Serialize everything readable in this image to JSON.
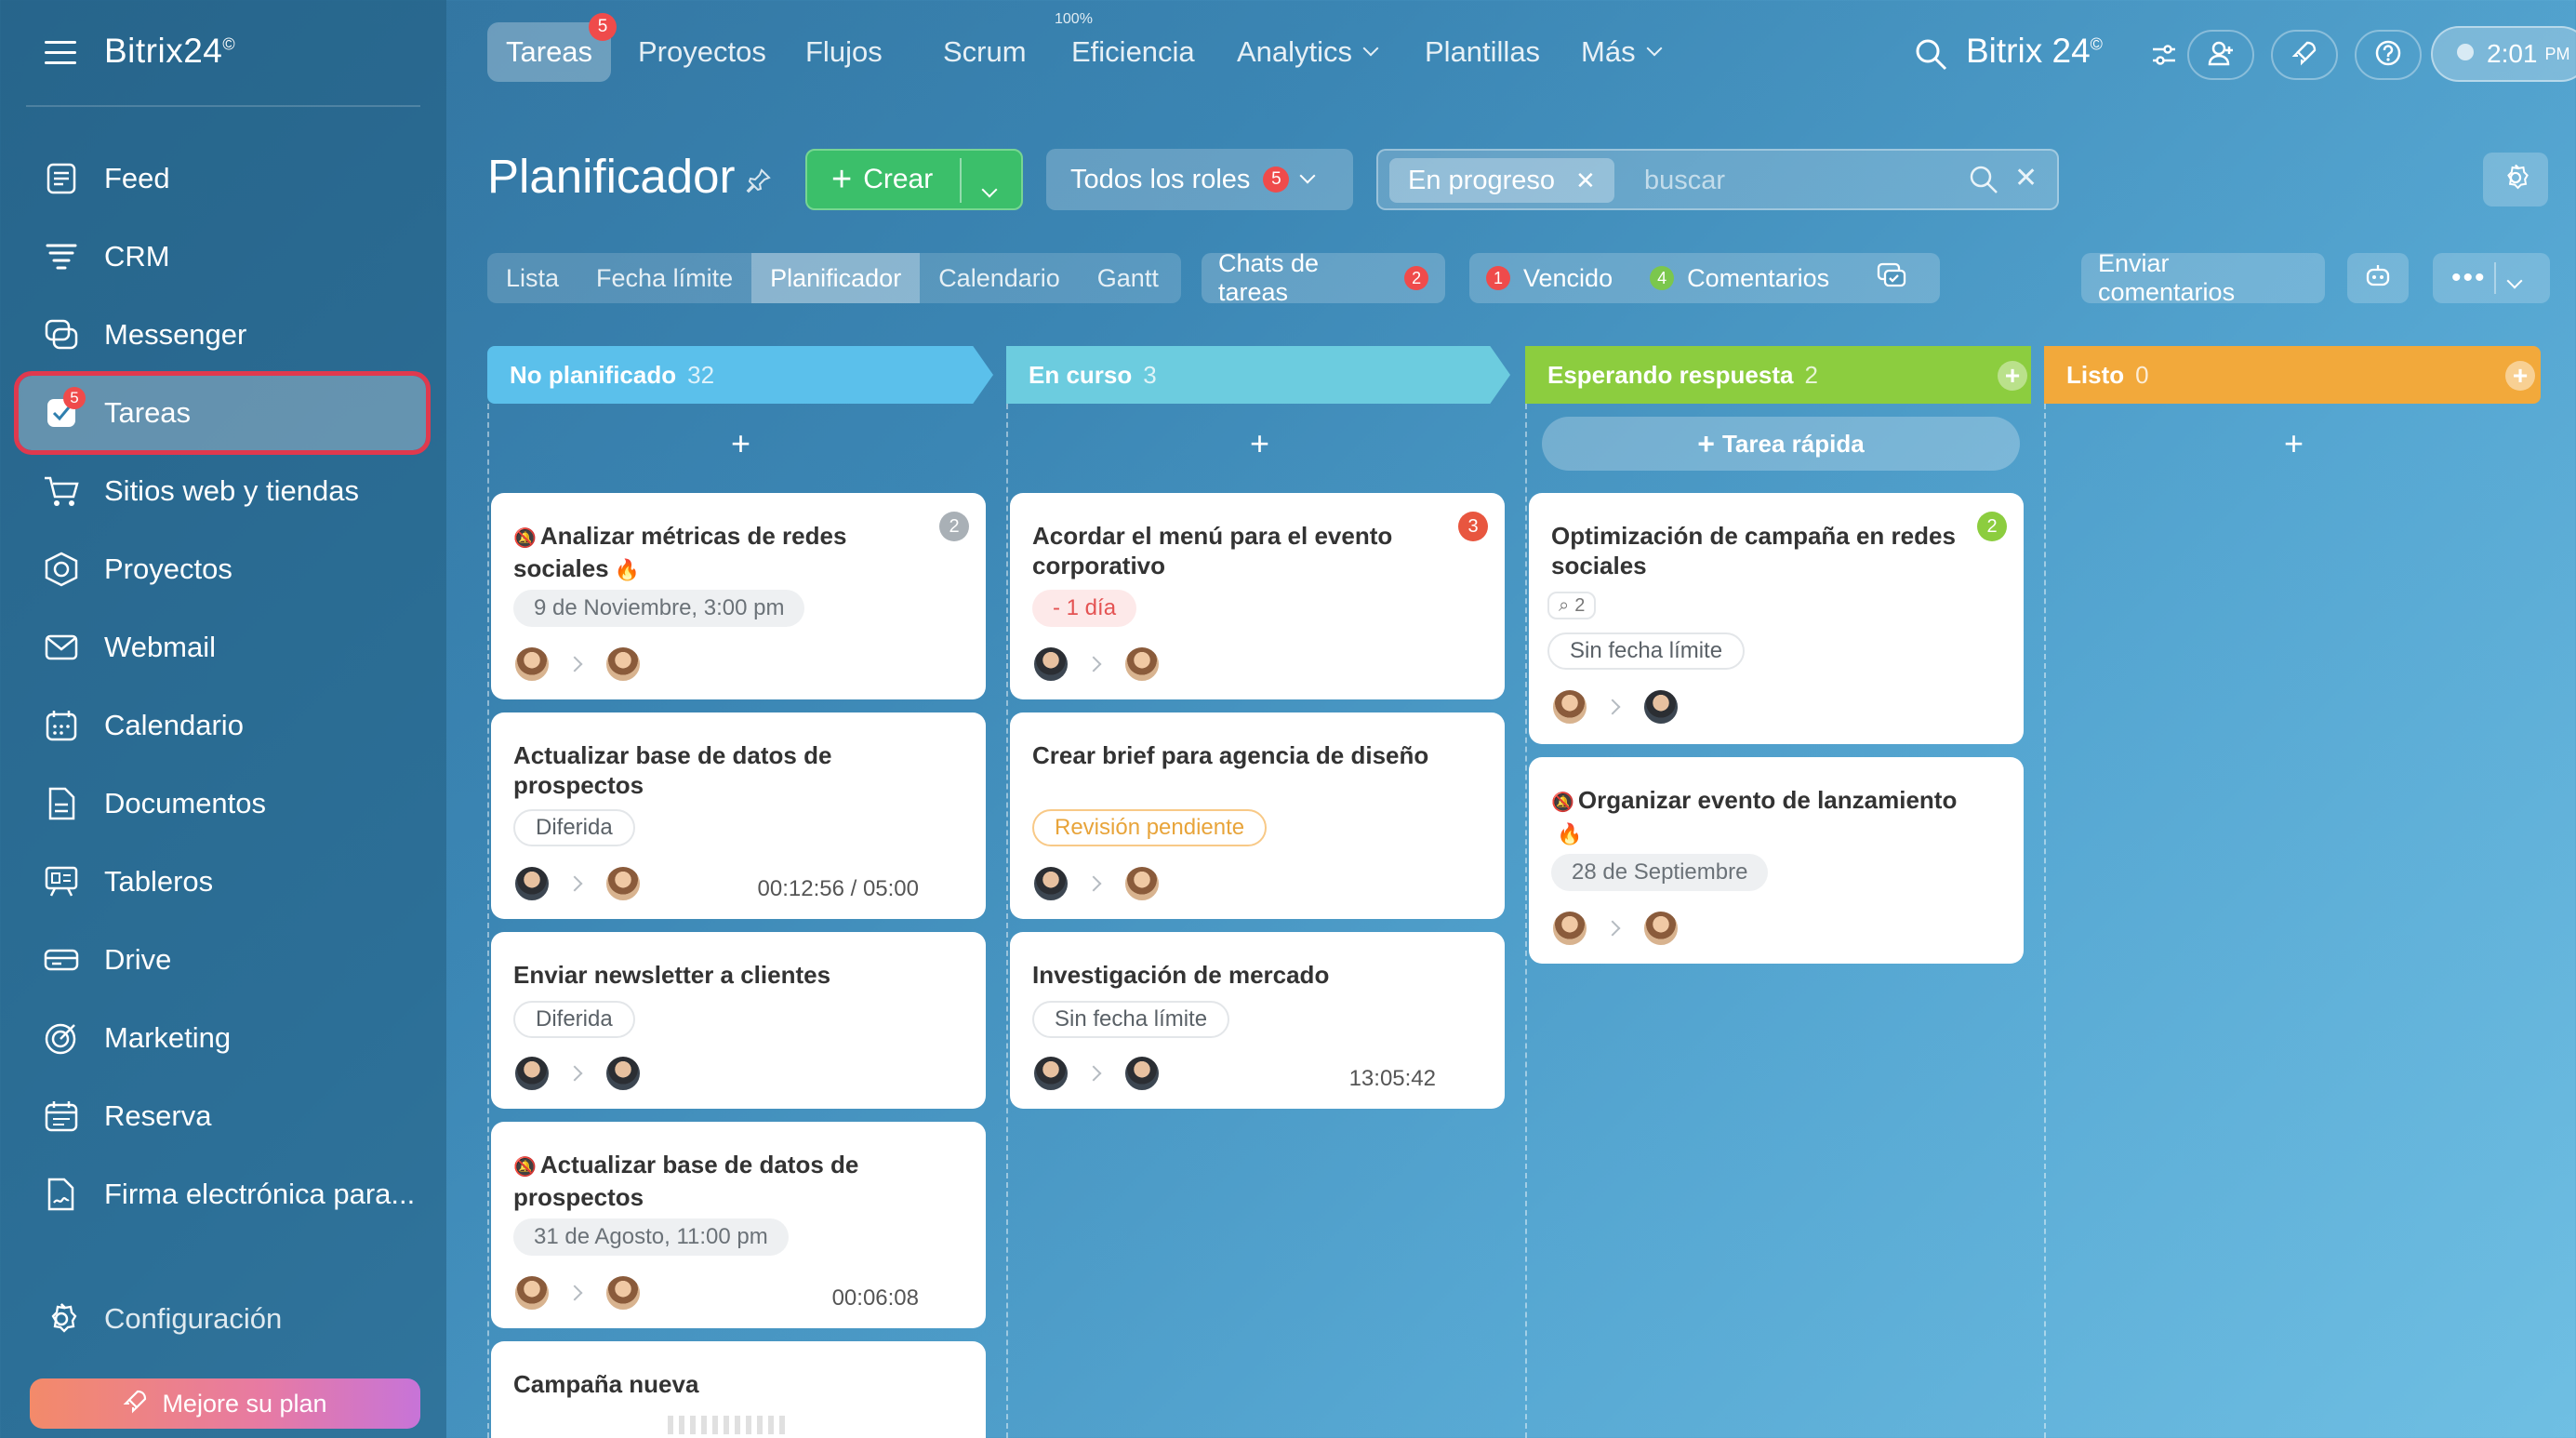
{
  "app": {
    "logo": "Bitrix24",
    "logo_mark": "©"
  },
  "sidebar": {
    "items": [
      {
        "label": "Feed",
        "icon": "feed-icon"
      },
      {
        "label": "CRM",
        "icon": "crm-icon"
      },
      {
        "label": "Messenger",
        "icon": "messenger-icon"
      },
      {
        "label": "Tareas",
        "icon": "tasks-icon",
        "badge": "5",
        "active": true
      },
      {
        "label": "Sitios web y tiendas",
        "icon": "cart-icon"
      },
      {
        "label": "Proyectos",
        "icon": "projects-icon"
      },
      {
        "label": "Webmail",
        "icon": "mail-icon"
      },
      {
        "label": "Calendario",
        "icon": "calendar-icon"
      },
      {
        "label": "Documentos",
        "icon": "document-icon"
      },
      {
        "label": "Tableros",
        "icon": "boards-icon"
      },
      {
        "label": "Drive",
        "icon": "drive-icon"
      },
      {
        "label": "Marketing",
        "icon": "marketing-icon"
      },
      {
        "label": "Reserva",
        "icon": "booking-icon"
      },
      {
        "label": "Firma electrónica para...",
        "icon": "signature-icon"
      }
    ],
    "settings_label": "Configuración",
    "upgrade_label": "Mejore su plan"
  },
  "topbar": {
    "tabs": [
      {
        "label": "Tareas",
        "badge": "5"
      },
      {
        "label": "Proyectos"
      },
      {
        "label": "Flujos"
      },
      {
        "label": "Scrum"
      },
      {
        "label": "Eficiencia",
        "over": "100%"
      },
      {
        "label": "Analytics"
      },
      {
        "label": "Plantillas"
      },
      {
        "label": "Más"
      }
    ],
    "brand": "Bitrix 24",
    "clock": "2:01",
    "clock_suffix": "PM"
  },
  "toolbar": {
    "title": "Planificador",
    "create_label": "Crear",
    "roles_label": "Todos los roles",
    "roles_badge": "5",
    "filter_chip": "En progreso",
    "search_placeholder": "buscar"
  },
  "views": {
    "tabs": [
      "Lista",
      "Fecha límite",
      "Planificador",
      "Calendario",
      "Gantt"
    ],
    "active": "Planificador",
    "chats_label": "Chats de tareas",
    "chats_badge": "2",
    "overdue_count": "1",
    "overdue_label": "Vencido",
    "comments_count": "4",
    "comments_label": "Comentarios",
    "feedback_label": "Enviar comentarios"
  },
  "columns": [
    {
      "title": "No planificado",
      "count": "32",
      "color": "#5bc0eb"
    },
    {
      "title": "En curso",
      "count": "3",
      "color": "#6cccdf"
    },
    {
      "title": "Esperando respuesta",
      "count": "2",
      "color": "#8ccd3f"
    },
    {
      "title": "Listo",
      "count": "0",
      "color": "#f2a93b"
    }
  ],
  "quick_task_label": "Tarea rápida",
  "cards": {
    "c1": {
      "title": "Analizar métricas de redes sociales",
      "badge": "2",
      "tag": "9 de Noviembre, 3:00 pm"
    },
    "c2": {
      "title": "Actualizar base de datos de prospectos",
      "tag": "Diferida",
      "timer": "00:12:56 / 05:00"
    },
    "c3": {
      "title": "Enviar newsletter a clientes",
      "tag": "Diferida"
    },
    "c4": {
      "title": "Actualizar base de datos de prospectos",
      "tag": "31 de Agosto, 11:00 pm",
      "timer": "00:06:08"
    },
    "c5": {
      "title": "Campaña nueva"
    },
    "c6": {
      "title": "Acordar el menú para el evento corporativo",
      "badge": "3",
      "tag": "- 1 día"
    },
    "c7": {
      "title": "Crear brief para agencia de diseño",
      "tag": "Revisión pendiente"
    },
    "c8": {
      "title": "Investigación de mercado",
      "tag": "Sin fecha límite",
      "timer": "13:05:42"
    },
    "c9": {
      "title": "Optimización de campaña en redes sociales",
      "badge": "2",
      "attach": "2",
      "tag": "Sin fecha límite"
    },
    "c10": {
      "title": "Organizar evento de lanzamiento",
      "tag": "28 de Septiembre"
    }
  }
}
